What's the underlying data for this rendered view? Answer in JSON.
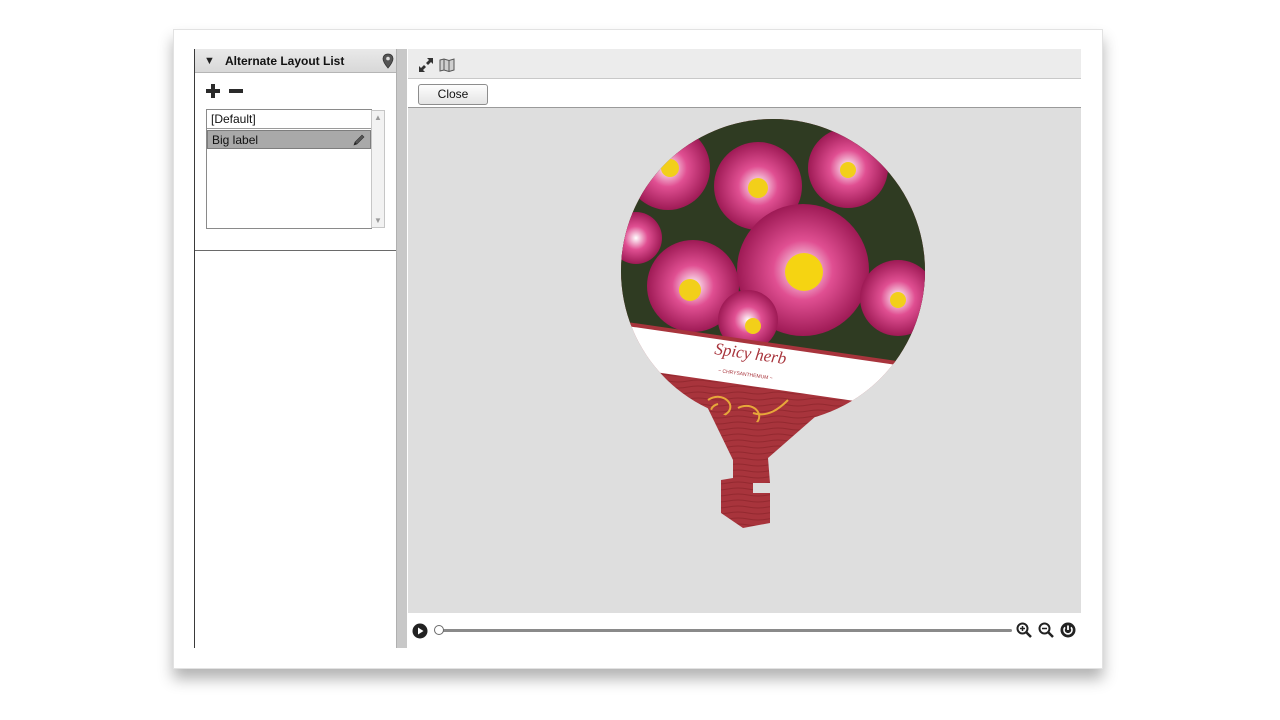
{
  "panel": {
    "title": "Alternate Layout List",
    "items": [
      {
        "label": "[Default]",
        "selected": false
      },
      {
        "label": "Big label",
        "selected": true
      }
    ]
  },
  "toolbar": {
    "close_label": "Close"
  },
  "preview": {
    "label_title": "Spicy herb",
    "label_subtitle": "~ CHRYSANTHEMUM ~"
  },
  "colors": {
    "accent_red": "#a8343c",
    "preview_bg": "#dedede",
    "selected_row": "#a9a9a9"
  },
  "icons": [
    "pin-icon",
    "plus-icon",
    "minus-icon",
    "pencil-icon",
    "expand-icon",
    "map-icon",
    "play-icon",
    "zoom-in-icon",
    "zoom-out-icon",
    "reset-icon"
  ]
}
